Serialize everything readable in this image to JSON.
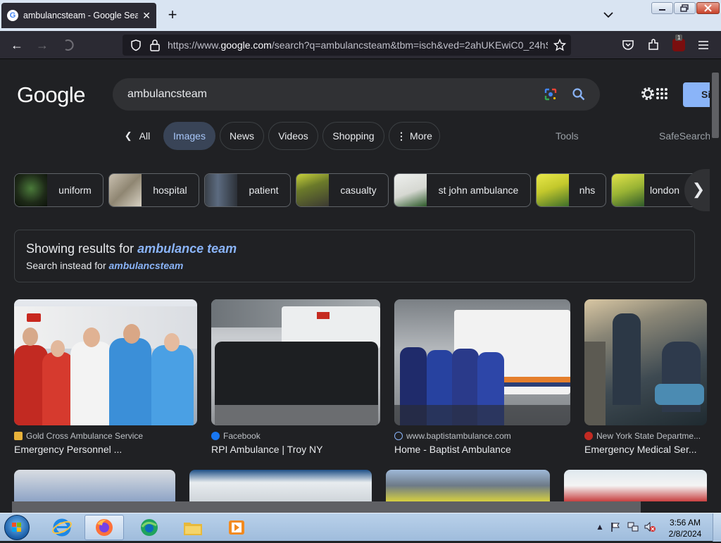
{
  "browser": {
    "tab_title": "ambulancsteam - Google Search",
    "url_prefix": "https://www.",
    "url_domain": "google.com",
    "url_rest": "/search?q=ambulancsteam&tbm=isch&ved=2ahUKEwiC0_24hS",
    "extension_badge": "1"
  },
  "google": {
    "logo": "Google",
    "query": "ambulancsteam",
    "signin_label": "Si",
    "tabs": [
      {
        "label": "All",
        "active": false
      },
      {
        "label": "Images",
        "active": true
      },
      {
        "label": "News",
        "active": false
      },
      {
        "label": "Videos",
        "active": false
      },
      {
        "label": "Shopping",
        "active": false
      },
      {
        "label": "More",
        "active": false
      }
    ],
    "tools_label": "Tools",
    "safesearch_label": "SafeSearch",
    "refinements": [
      "uniform",
      "hospital",
      "patient",
      "casualty",
      "st john ambulance",
      "nhs",
      "london"
    ],
    "spell": {
      "showing_prefix": "Showing results for ",
      "corrected": "ambulance team",
      "instead_prefix": "Search instead for ",
      "original": "ambulancsteam"
    },
    "results": [
      {
        "source": "Gold Cross Ambulance Service",
        "title": "Emergency Personnel ..."
      },
      {
        "source": "Facebook",
        "title": "RPI Ambulance | Troy NY"
      },
      {
        "source": "www.baptistambulance.com",
        "title": "Home - Baptist Ambulance"
      },
      {
        "source": "New York State Departme...",
        "title": "Emergency Medical Ser..."
      }
    ]
  },
  "taskbar": {
    "time": "3:56 AM",
    "date": "2/8/2024"
  }
}
